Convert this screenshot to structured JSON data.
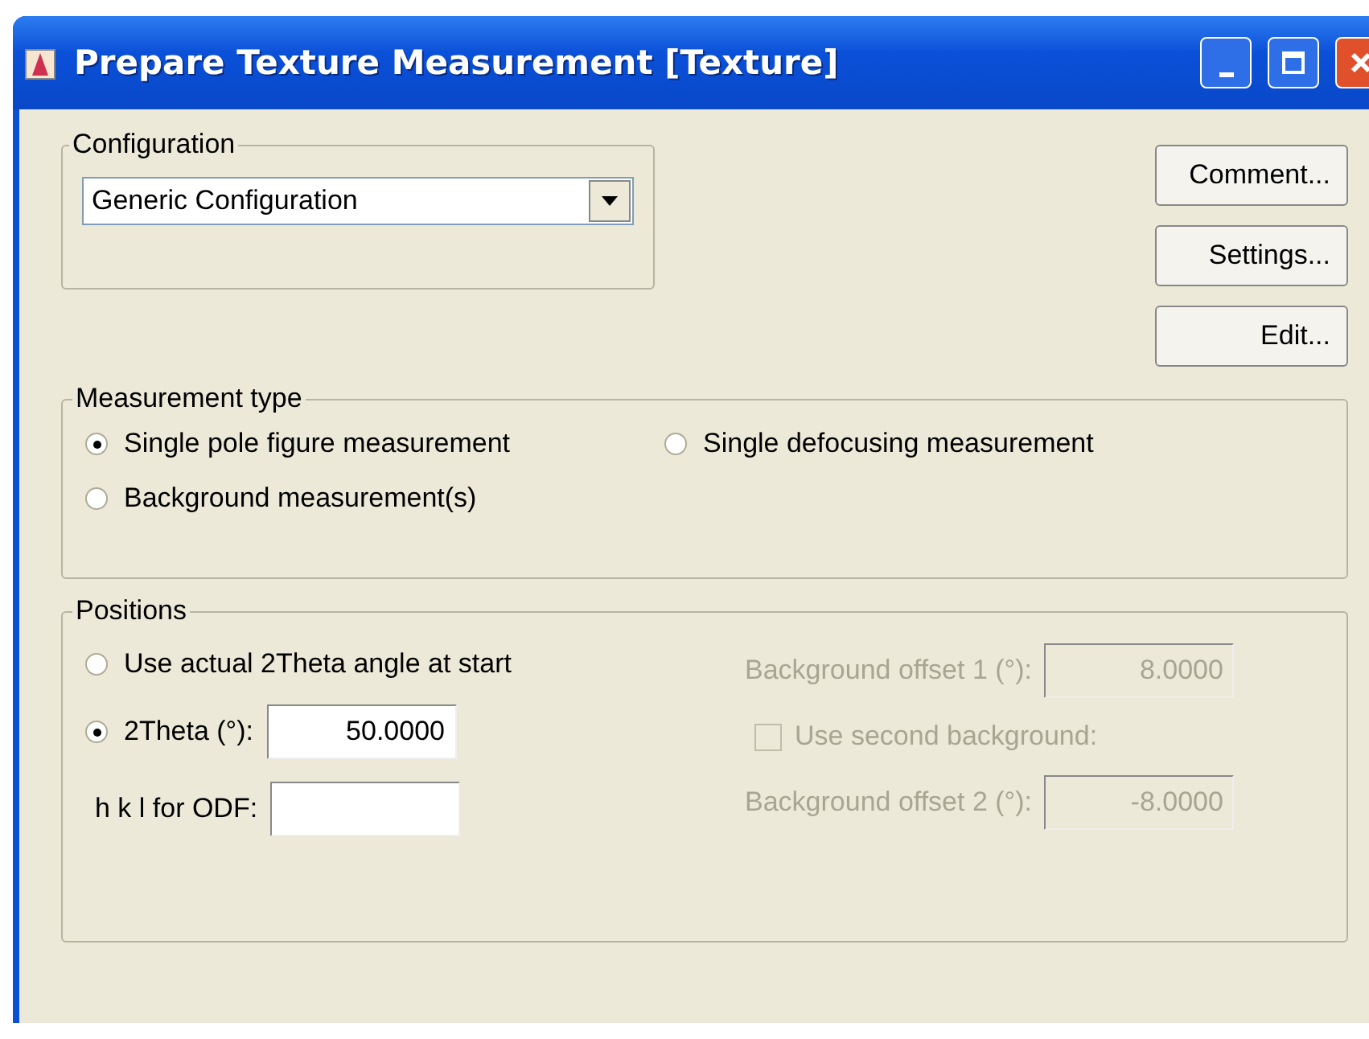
{
  "window": {
    "title": "Prepare Texture Measurement [Texture]"
  },
  "configuration": {
    "legend": "Configuration",
    "value": "Generic Configuration"
  },
  "buttons": [
    "Comment...",
    "Settings...",
    "Edit..."
  ],
  "measurement_type": {
    "legend": "Measurement type",
    "options": [
      {
        "label": "Single pole figure measurement",
        "selected": true
      },
      {
        "label": "Single defocusing measurement",
        "selected": false
      },
      {
        "label": "Background measurement(s)",
        "selected": false
      }
    ]
  },
  "positions": {
    "legend": "Positions",
    "options": [
      {
        "label": "Use actual 2Theta angle at start",
        "selected": false
      },
      {
        "label": "2Theta (°):",
        "selected": true,
        "value": "50.0000"
      }
    ],
    "hkl": {
      "label": "h k l for ODF:"
    },
    "background_offset_1": {
      "label": "Background offset 1 (°):",
      "value": "8.0000",
      "disabled": true
    },
    "second_background": {
      "label": "Use second background:",
      "checked": false,
      "disabled": true
    },
    "background_offset_2": {
      "label": "Background offset 2 (°):",
      "value": "-8.0000",
      "disabled": true
    }
  }
}
